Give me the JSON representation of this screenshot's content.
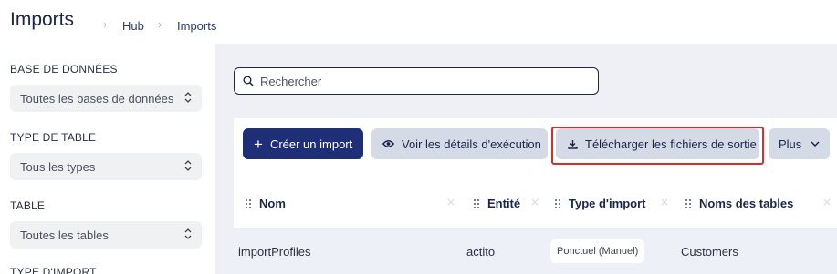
{
  "header": {
    "title": "Imports",
    "breadcrumbs": [
      "Hub",
      "Imports"
    ]
  },
  "sidebar": {
    "filters": [
      {
        "label": "BASE DE DONNÉES",
        "value": "Toutes les bases de données"
      },
      {
        "label": "TYPE DE TABLE",
        "value": "Tous les types"
      },
      {
        "label": "TABLE",
        "value": "Toutes les tables"
      },
      {
        "label": "TYPE D'IMPORT",
        "value": ""
      }
    ]
  },
  "search": {
    "placeholder": "Rechercher",
    "value": ""
  },
  "toolbar": {
    "create_label": "Créer un import",
    "details_label": "Voir les détails d'exécution",
    "download_label": "Télécharger les fichiers de sortie",
    "more_label": "Plus"
  },
  "table": {
    "columns": [
      "Nom",
      "Entité",
      "Type d'import",
      "Noms des tables"
    ],
    "rows": [
      {
        "name": "importProfiles",
        "entity": "actito",
        "import_type": "Ponctuel (Manuel)",
        "table_names": "Customers"
      }
    ]
  },
  "colors": {
    "primary": "#1e2f78",
    "secondary": "#d5dbe6",
    "highlight": "#d92b2b",
    "main_bg": "#eef0f5"
  }
}
